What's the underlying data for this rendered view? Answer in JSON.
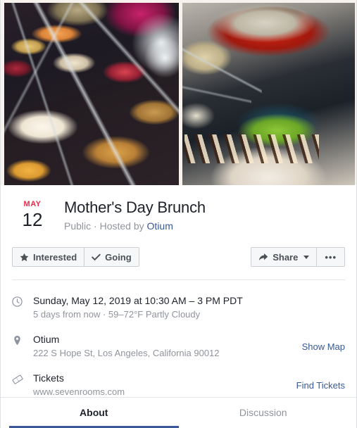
{
  "cover": {
    "photos": [
      {
        "name": "brunch-buffet-bowls-photo",
        "alt": "Buffet table with bowls of yogurt, granola, fresh berries and dried fruit with serving spoons"
      },
      {
        "name": "dishes-photo",
        "alt": "Red casserole dish, blue bowl of green soup and a white bowl with chocolate-drizzled pastry"
      }
    ]
  },
  "header": {
    "date": {
      "month": "MAY",
      "day": "12"
    },
    "title": "Mother's Day Brunch",
    "privacy": "Public",
    "hosted_by_prefix": "Hosted by",
    "separator": "·",
    "host_name": "Otium"
  },
  "actions": {
    "interested_label": "Interested",
    "going_label": "Going",
    "share_label": "Share",
    "more_label": "•••"
  },
  "details": {
    "time": {
      "icon": "clock-icon",
      "primary": "Sunday, May 12, 2019 at 10:30 AM – 3 PM PDT",
      "secondary": "5 days from now · 59–72°F Partly Cloudy"
    },
    "location": {
      "icon": "map-pin-icon",
      "primary": "Otium",
      "secondary": "222 S Hope St, Los Angeles, California 90012",
      "action": "Show Map"
    },
    "tickets": {
      "icon": "ticket-icon",
      "primary": "Tickets",
      "secondary": "www.sevenrooms.com",
      "action": "Find Tickets"
    }
  },
  "tabs": [
    {
      "label": "About",
      "active": true
    },
    {
      "label": "Discussion",
      "active": false
    }
  ],
  "colors": {
    "accent_red": "#f02849",
    "link_blue": "#385898",
    "tab_active_underline": "#3b5998",
    "text_primary": "#1d2129",
    "text_muted": "#90949c"
  }
}
